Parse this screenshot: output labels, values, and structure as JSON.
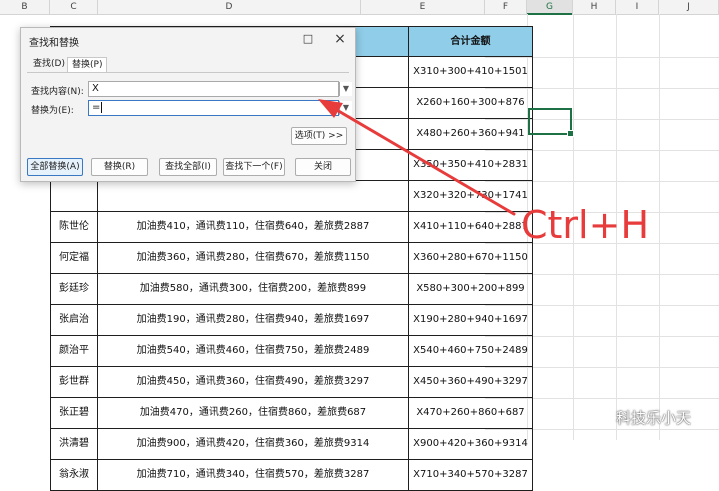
{
  "columns": [
    "B",
    "C",
    "D",
    "E",
    "F",
    "G",
    "H",
    "I",
    "J"
  ],
  "table": {
    "header": [
      "",
      "",
      "合计金额"
    ],
    "rows": [
      [
        "",
        "",
        "X310+300+410+1501"
      ],
      [
        "",
        "",
        "X260+160+300+876"
      ],
      [
        "",
        "",
        "X480+260+360+941"
      ],
      [
        "",
        "",
        "X350+350+410+2831"
      ],
      [
        "",
        "",
        "X320+320+730+1741"
      ],
      [
        "陈世伦",
        "加油费410，通讯费110，住宿费640，差旅费2887",
        "X410+110+640+2887"
      ],
      [
        "何定福",
        "加油费360，通讯费280，住宿费670，差旅费1150",
        "X360+280+670+1150"
      ],
      [
        "彭廷珍",
        "加油费580，通讯费300，住宿费200，差旅费899",
        "X580+300+200+899"
      ],
      [
        "张启治",
        "加油费190，通讯费280，住宿费940，差旅费1697",
        "X190+280+940+1697"
      ],
      [
        "颜治平",
        "加油费540，通讯费460，住宿费750，差旅费2489",
        "X540+460+750+2489"
      ],
      [
        "彭世群",
        "加油费450，通讯费360，住宿费490，差旅费3297",
        "X450+360+490+3297"
      ],
      [
        "张正碧",
        "加油费470，通讯费260，住宿费860，差旅费687",
        "X470+260+860+687"
      ],
      [
        "洪清碧",
        "加油费900，通讯费420，住宿费360，差旅费9314",
        "X900+420+360+9314"
      ],
      [
        "翁永淑",
        "加油费710，通讯费340，住宿费570，差旅费3287",
        "X710+340+570+3287"
      ]
    ]
  },
  "dialog": {
    "title": "查找和替换",
    "maximize_icon": "□",
    "close_icon": "×",
    "tabs": [
      "查找(D)",
      "替换(P)"
    ],
    "find_label": "查找内容(N):",
    "find_value": "X",
    "replace_label": "替换为(E):",
    "replace_value": "=",
    "options_button": "选项(T) >>",
    "buttons": [
      "全部替换(A)",
      "替换(R)",
      "查找全部(I)",
      "查找下一个(F)",
      "关闭"
    ]
  },
  "annotation": {
    "shortcut": "Ctrl+H",
    "color": "#e83b3b"
  },
  "watermark": "科技乐小天",
  "colors": {
    "header_fill": "#8fcde8",
    "selection": "#1e7145",
    "button_accent": "#3b78c4"
  }
}
